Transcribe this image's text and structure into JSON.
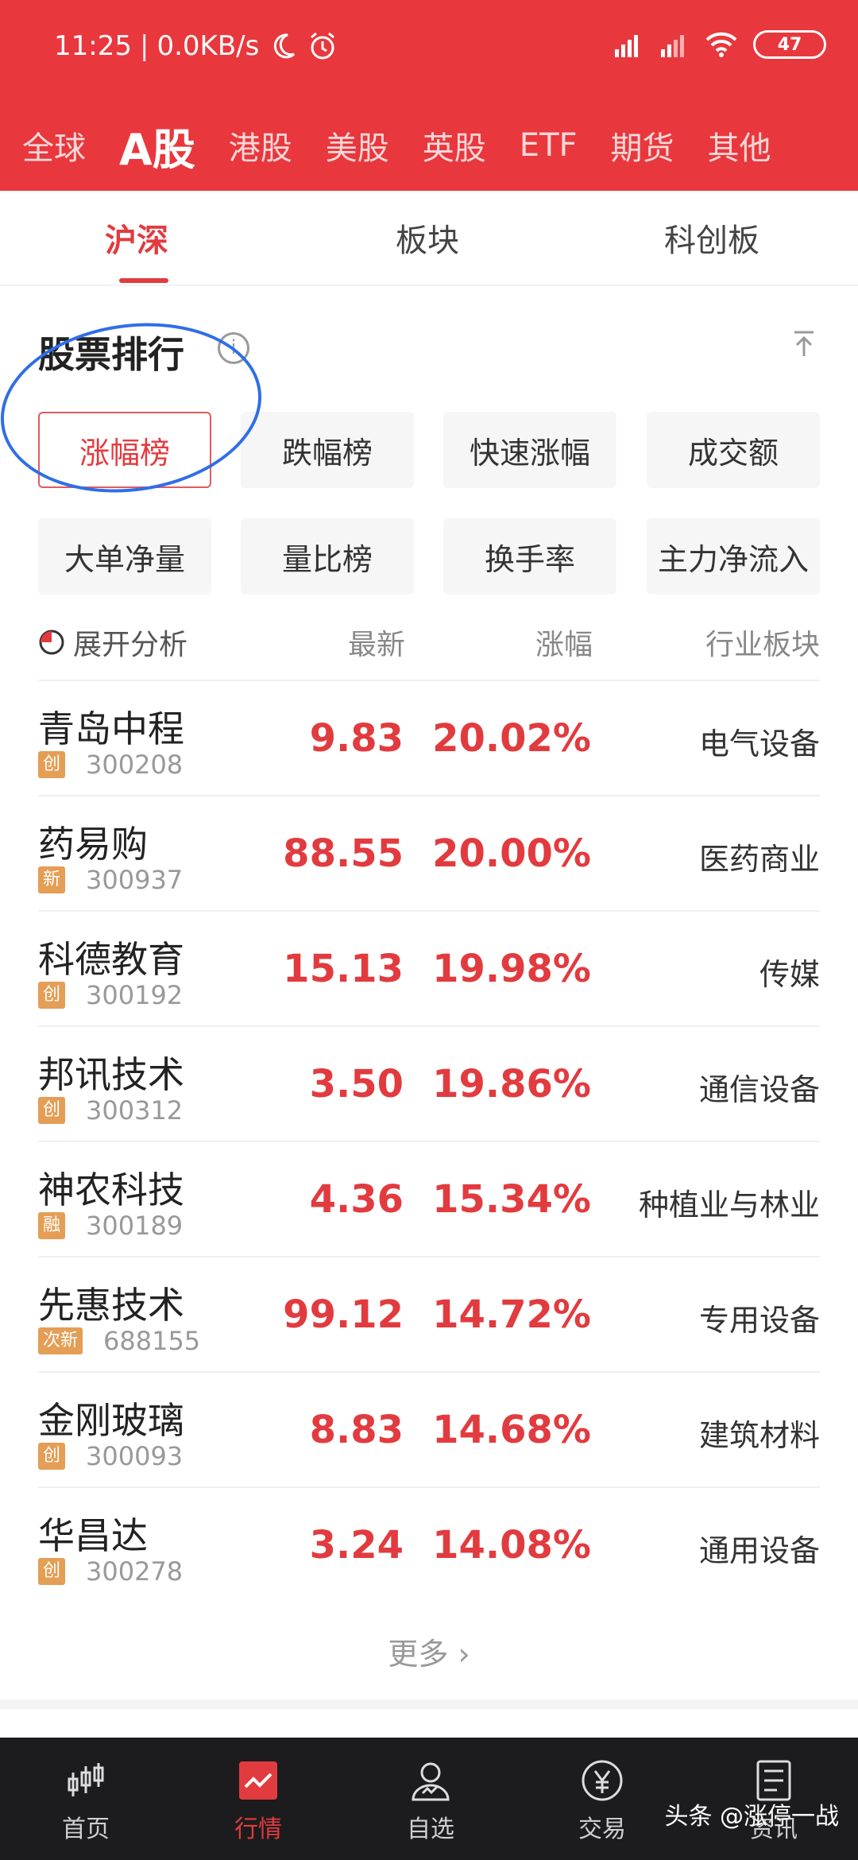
{
  "status_bar": {
    "time": "11:25",
    "network_speed": "0.0KB/s",
    "battery": "47"
  },
  "market_tabs": [
    {
      "label": "全球",
      "active": false
    },
    {
      "label": "A股",
      "active": true
    },
    {
      "label": "港股",
      "active": false
    },
    {
      "label": "美股",
      "active": false
    },
    {
      "label": "英股",
      "active": false
    },
    {
      "label": "ETF",
      "active": false
    },
    {
      "label": "期货",
      "active": false
    },
    {
      "label": "其他",
      "active": false
    }
  ],
  "sub_tabs": [
    {
      "label": "沪深",
      "active": true
    },
    {
      "label": "板块",
      "active": false
    },
    {
      "label": "科创板",
      "active": false
    }
  ],
  "section": {
    "title": "股票排行",
    "info_icon": "info-icon",
    "top_icon": "scroll-top-icon"
  },
  "filters": [
    {
      "label": "涨幅榜",
      "active": true
    },
    {
      "label": "跌幅榜",
      "active": false
    },
    {
      "label": "快速涨幅",
      "active": false
    },
    {
      "label": "成交额",
      "active": false
    },
    {
      "label": "大单净量",
      "active": false
    },
    {
      "label": "量比榜",
      "active": false
    },
    {
      "label": "换手率",
      "active": false
    },
    {
      "label": "主力净流入",
      "active": false
    }
  ],
  "table": {
    "analysis_label": "展开分析",
    "headers": {
      "latest": "最新",
      "change": "涨幅",
      "sector": "行业板块"
    },
    "rows": [
      {
        "name": "青岛中程",
        "tag": "创",
        "code": "300208",
        "price": "9.83",
        "change": "20.02%",
        "sector": "电气设备"
      },
      {
        "name": "药易购",
        "tag": "新",
        "code": "300937",
        "price": "88.55",
        "change": "20.00%",
        "sector": "医药商业"
      },
      {
        "name": "科德教育",
        "tag": "创",
        "code": "300192",
        "price": "15.13",
        "change": "19.98%",
        "sector": "传媒"
      },
      {
        "name": "邦讯技术",
        "tag": "创",
        "code": "300312",
        "price": "3.50",
        "change": "19.86%",
        "sector": "通信设备"
      },
      {
        "name": "神农科技",
        "tag": "融",
        "code": "300189",
        "price": "4.36",
        "change": "15.34%",
        "sector": "种植业与林业"
      },
      {
        "name": "先惠技术",
        "tag": "次新",
        "code": "688155",
        "price": "99.12",
        "change": "14.72%",
        "sector": "专用设备"
      },
      {
        "name": "金刚玻璃",
        "tag": "创",
        "code": "300093",
        "price": "8.83",
        "change": "14.68%",
        "sector": "建筑材料"
      },
      {
        "name": "华昌达",
        "tag": "创",
        "code": "300278",
        "price": "3.24",
        "change": "14.08%",
        "sector": "通用设备"
      }
    ]
  },
  "more_label": "更多",
  "bottom_nav": [
    {
      "label": "首页",
      "icon": "candlestick-icon",
      "active": false
    },
    {
      "label": "行情",
      "icon": "market-chart-icon",
      "active": true
    },
    {
      "label": "自选",
      "icon": "watchlist-user-icon",
      "active": false
    },
    {
      "label": "交易",
      "icon": "yen-coin-icon",
      "active": false
    },
    {
      "label": "资讯",
      "icon": "news-document-icon",
      "active": false
    }
  ],
  "watermark": "头条 @涨停一战",
  "colors": {
    "brand_red": "#e8383d",
    "up_red": "#e23b3f",
    "tag_orange": "#e49e55",
    "annotation_blue": "#2f6ee8"
  }
}
